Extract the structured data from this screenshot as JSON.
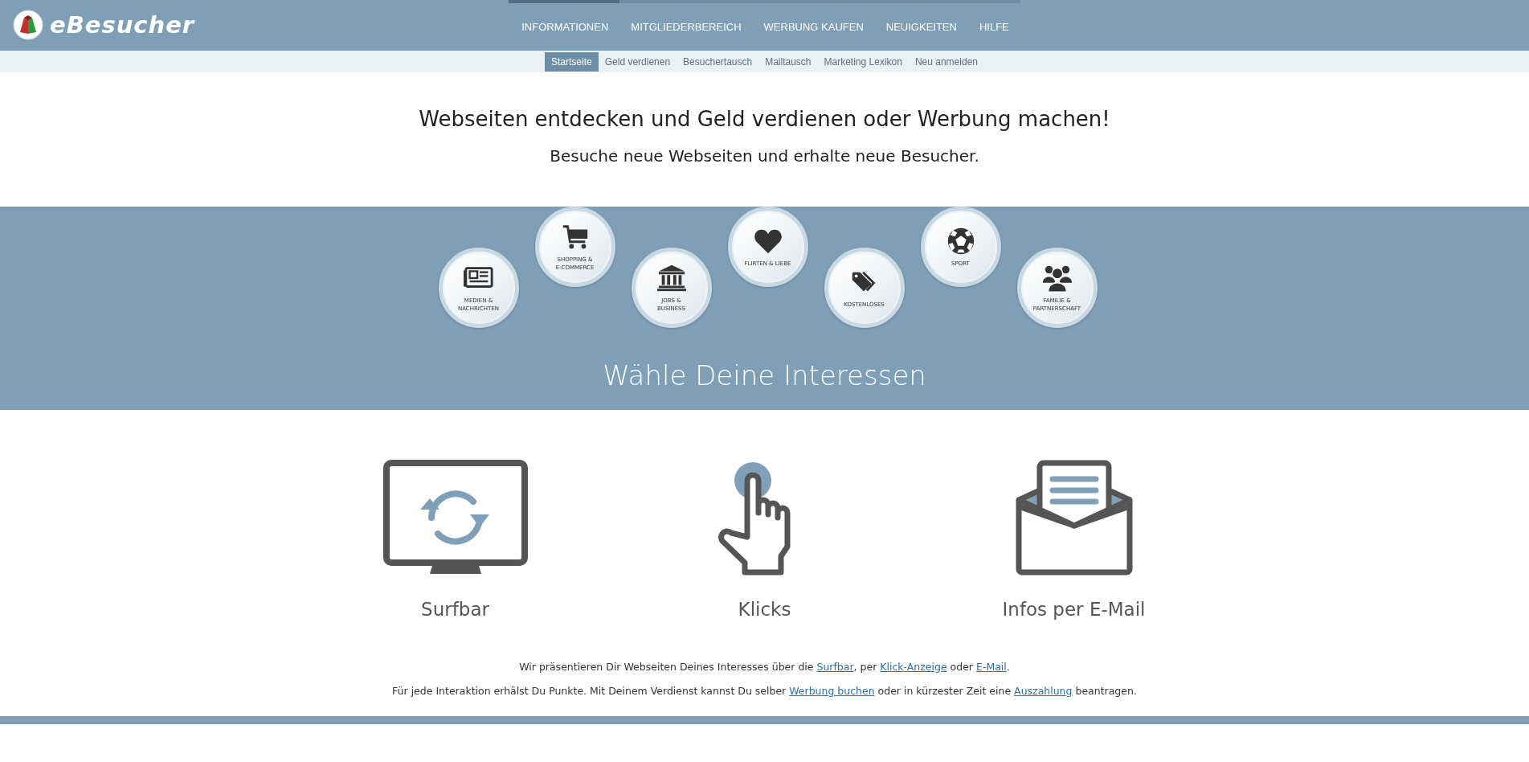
{
  "logo": {
    "text": "eBesucher"
  },
  "nav": [
    {
      "label": "INFORMATIONEN",
      "selected": true
    },
    {
      "label": "MITGLIEDERBEREICH",
      "selected": false
    },
    {
      "label": "WERBUNG KAUFEN",
      "selected": false
    },
    {
      "label": "NEUIGKEITEN",
      "selected": false
    },
    {
      "label": "HILFE",
      "selected": false
    }
  ],
  "subnav": [
    {
      "label": "Startseite",
      "selected": true
    },
    {
      "label": "Geld verdienen",
      "selected": false
    },
    {
      "label": "Besuchertausch",
      "selected": false
    },
    {
      "label": "Mailtausch",
      "selected": false
    },
    {
      "label": "Marketing Lexikon",
      "selected": false
    },
    {
      "label": "Neu anmelden",
      "selected": false
    }
  ],
  "headline": "Webseiten entdecken und Geld verdienen oder Werbung machen!",
  "subheadline": "Besuche neue Webseiten und erhalte neue Besucher.",
  "interests": [
    {
      "label": "MEDIEN &\nNACHRICHTEN"
    },
    {
      "label": "SHOPPING &\nE-COMMERCE"
    },
    {
      "label": "JOBS &\nBUSINESS"
    },
    {
      "label": "FLIRTEN & LIEBE"
    },
    {
      "label": "KOSTENLOSES"
    },
    {
      "label": "SPORT"
    },
    {
      "label": "FAMILIE &\nPARTNERSCHAFT"
    }
  ],
  "interests_title": "Wähle Deine Interessen",
  "features": [
    {
      "label": "Surfbar"
    },
    {
      "label": "Klicks"
    },
    {
      "label": "Infos per E-Mail"
    }
  ],
  "paragraphs": [
    [
      {
        "text": "Wir präsentieren Dir Webseiten Deines Interesses über die "
      },
      {
        "link": "Surfbar"
      },
      {
        "text": ", per "
      },
      {
        "link": "Klick-Anzeige"
      },
      {
        "text": " oder "
      },
      {
        "link": "E-Mail"
      },
      {
        "text": "."
      }
    ],
    [
      {
        "text": "Für jede Interaktion erhälst Du Punkte. Mit Deinem Verdienst kannst Du selber "
      },
      {
        "link": "Werbung buchen"
      },
      {
        "text": " oder in kürzester Zeit eine "
      },
      {
        "link": "Auszahlung"
      },
      {
        "text": " beantragen."
      }
    ]
  ]
}
